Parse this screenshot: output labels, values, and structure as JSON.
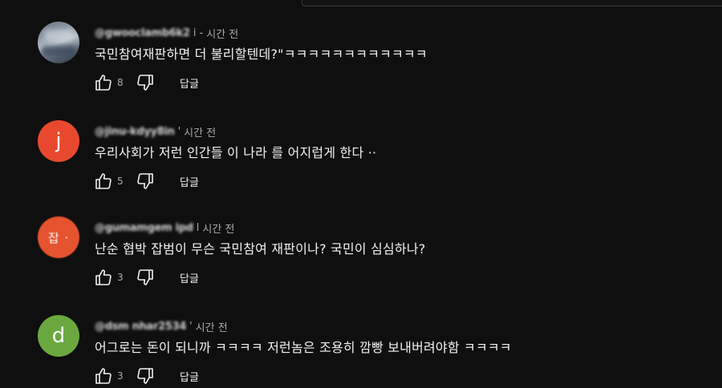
{
  "comments": [
    {
      "username": "@gwooclamb6k2",
      "time": "시간 전",
      "time_prefix": "i -",
      "avatar": {
        "type": "photo",
        "color": "#8e9aa8"
      },
      "text": "국민참여재판하면 더 불리할텐데?\"ㅋㅋㅋㅋㅋㅋㅋㅋㅋㅋㅋㅋ",
      "likes": "8",
      "reply_label": "답글"
    },
    {
      "username": "@jinu-kdyy8in",
      "time": "시간 전",
      "time_prefix": "'",
      "avatar": {
        "type": "letter",
        "letter": "j",
        "color": "#e8492e"
      },
      "text": "우리사회가 저런 인간들 이 나라 를  어지럽게 한다 ··",
      "likes": "5",
      "reply_label": "답글"
    },
    {
      "username": "@gumamgem ipd",
      "time": "시간 전",
      "time_prefix": "l",
      "avatar": {
        "type": "text",
        "letter": "잡 ·",
        "color": "#e5532f"
      },
      "text": "난순 협박 잡범이 무슨 국민참여 재판이나? 국민이 심심하나?",
      "likes": "3",
      "reply_label": "답글"
    },
    {
      "username": "@dsm nhar2534",
      "time": "시간 전",
      "time_prefix": "'",
      "avatar": {
        "type": "letter",
        "letter": "d",
        "color": "#6aa83f"
      },
      "text": "어그로는 돈이 되니까 ㅋㅋㅋㅋ 저런놈은 조용히 깜빵 보내버려야함 ㅋㅋㅋㅋ",
      "likes": "3",
      "reply_label": "답글"
    }
  ]
}
